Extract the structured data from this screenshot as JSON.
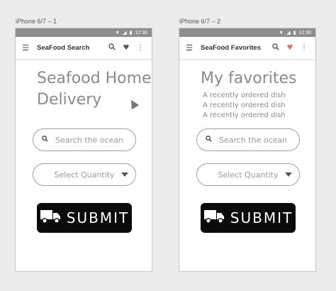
{
  "artboards": [
    {
      "label": "iPhone 6/7 – 1",
      "status_time": "12:30",
      "appbar_title": "SeaFood Search",
      "heading_line1": "Seafood Home",
      "heading_line2": "Delivery",
      "search_placeholder": "Search the ocean",
      "select_value": "Select Quantity",
      "submit_label": "SUBMIT"
    },
    {
      "label": "iPhone 6/7 – 2",
      "status_time": "12:30",
      "appbar_title": "SeaFood Favorites",
      "heading": "My favorites",
      "favorites": [
        "A recently ordered dish",
        "A recently ordered dish",
        "A recently ordered dish"
      ],
      "search_placeholder": "Search the ocean",
      "select_value": "Select Quantity",
      "submit_label": "SUBMIT"
    }
  ],
  "colors": {
    "background": "#ececec",
    "statusbar": "#8e8e8e",
    "heart_active": "#e07070",
    "button": "#0b0b0b"
  },
  "icons": [
    "menu-icon",
    "search-icon",
    "heart-icon",
    "more-vert-icon",
    "truck-icon",
    "chevron-down-icon"
  ]
}
